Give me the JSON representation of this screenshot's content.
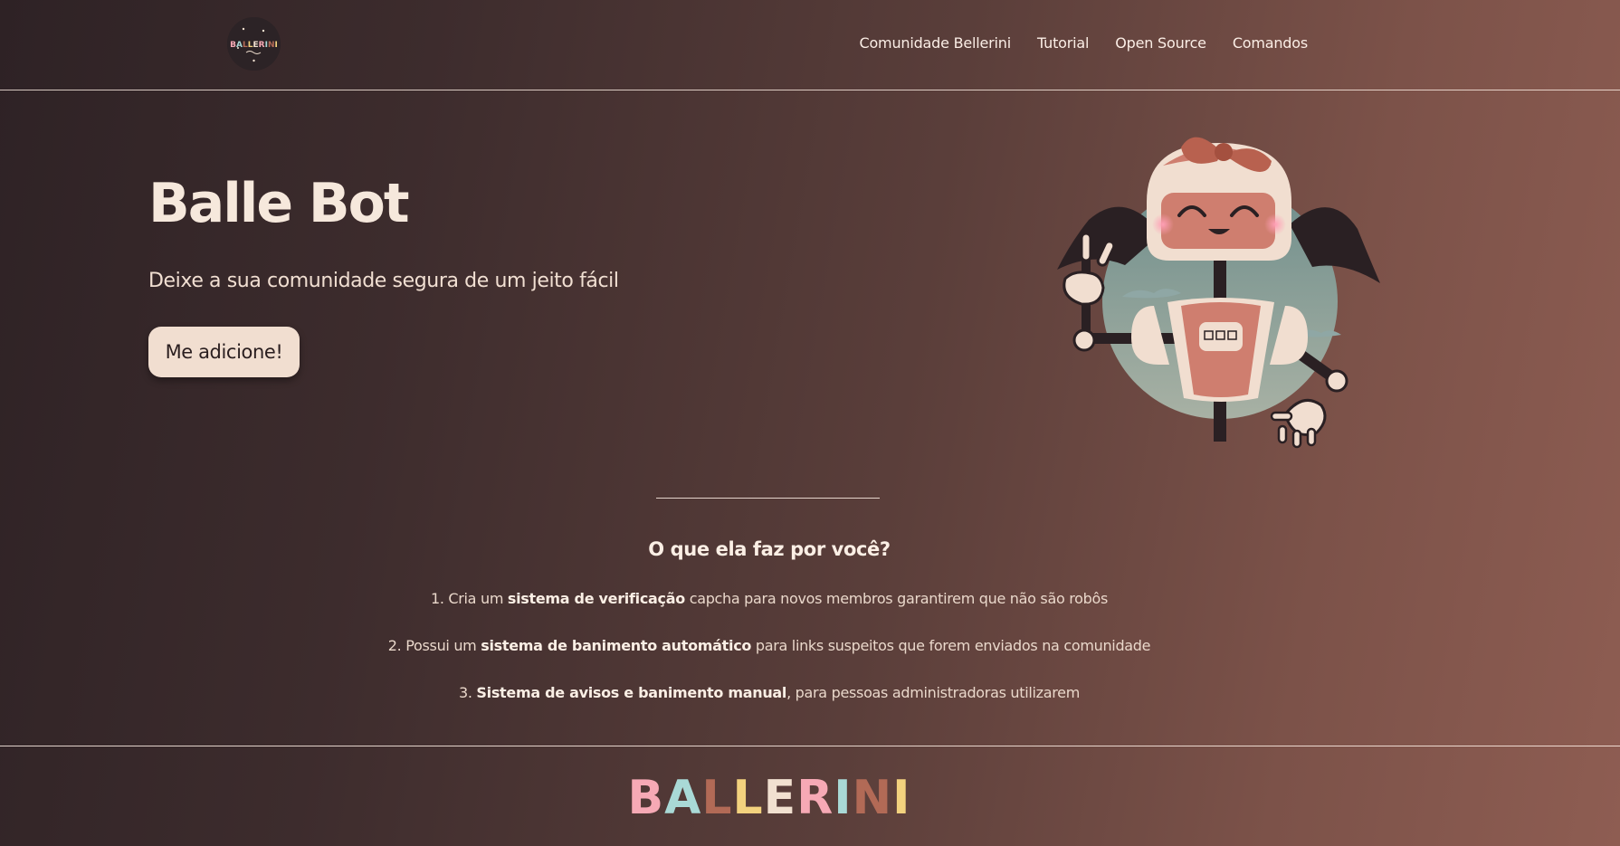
{
  "nav": {
    "logo_text": "BALLERINI",
    "links": [
      "Comunidade Bellerini",
      "Tutorial",
      "Open Source",
      "Comandos"
    ]
  },
  "hero": {
    "title": "Balle Bot",
    "subtitle": "Deixe a sua comunidade segura de um jeito fácil",
    "cta_label": "Me adicione!"
  },
  "features": {
    "title": "O que ela faz por você?",
    "items": [
      {
        "prefix": "1. Cria um ",
        "bold": "sistema de verificação",
        "suffix": " capcha para novos membros garantirem que não são robôs"
      },
      {
        "prefix": "2. Possui um ",
        "bold": "sistema de banimento automático",
        "suffix": " para links suspeitos que forem enviados na comunidade"
      },
      {
        "prefix": "3. ",
        "bold": "Sistema de avisos e banimento manual",
        "suffix": ", para pessoas administradoras utilizarem"
      }
    ]
  },
  "footer": {
    "letters": [
      "B",
      "A",
      "L",
      "L",
      "E",
      "R",
      "I",
      "N",
      "I"
    ],
    "letter_colors": [
      "#f6a9b5",
      "#a9d9d6",
      "#b26a56",
      "#f3d27e",
      "#f1e0d0",
      "#f6a9b5",
      "#a9d9d6",
      "#b26a56",
      "#f3d27e"
    ]
  },
  "colors": {
    "background_dark": "#2e2225",
    "background_light": "#8e5d52",
    "text_light": "#f6e8dc",
    "button_bg": "#f1ded0"
  },
  "icons": {
    "logo": "ballerini-logo-icon",
    "mascot": "robot-mascot-illustration"
  }
}
